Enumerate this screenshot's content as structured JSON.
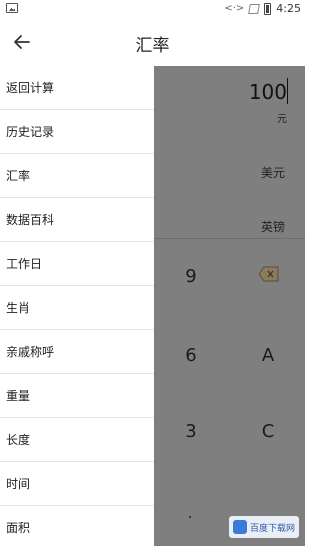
{
  "status_bar": {
    "time": "4:25",
    "network": "<·>"
  },
  "header": {
    "title": "汇率"
  },
  "drawer": {
    "items": [
      {
        "label": "返回计算"
      },
      {
        "label": "历史记录"
      },
      {
        "label": "汇率"
      },
      {
        "label": "数据百科"
      },
      {
        "label": "工作日"
      },
      {
        "label": "生肖"
      },
      {
        "label": "亲戚称呼"
      },
      {
        "label": "重量"
      },
      {
        "label": "长度"
      },
      {
        "label": "时间"
      },
      {
        "label": "面积"
      }
    ]
  },
  "calculator": {
    "input_value": "100",
    "input_unit": "元",
    "currency_1": "美元",
    "currency_2": "英镑",
    "keys": [
      "9",
      "6",
      "A",
      "3",
      "C"
    ]
  },
  "watermark": {
    "text": "百度下载网"
  },
  "colors": {
    "overlay": "#7f7f7f",
    "drawer_bg": "#ffffff",
    "divider": "#e4e4e4"
  }
}
